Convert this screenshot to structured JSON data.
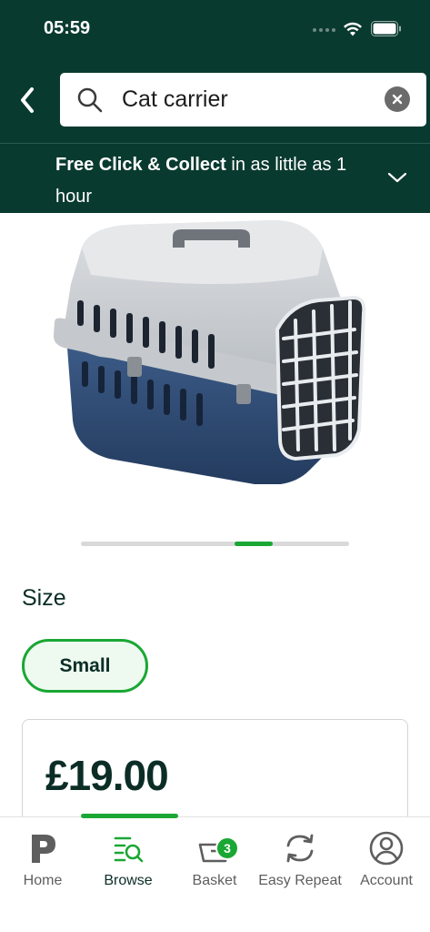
{
  "status_bar": {
    "time": "05:59"
  },
  "search": {
    "query": "Cat carrier"
  },
  "collect_banner": {
    "bold": "Free Click & Collect",
    "rest": " in as little as 1 hour"
  },
  "product": {
    "size_label": "Size",
    "size_option": "Small",
    "price": "£19.00",
    "carousel": {
      "total_pages": 7,
      "active_page": 5
    }
  },
  "tab_bar": {
    "tabs": [
      {
        "label": "Home",
        "icon": "p-logo-icon",
        "active": false
      },
      {
        "label": "Browse",
        "icon": "browse-search-icon",
        "active": true
      },
      {
        "label": "Basket",
        "icon": "basket-icon",
        "active": false,
        "badge": "3"
      },
      {
        "label": "Easy Repeat",
        "icon": "repeat-icon",
        "active": false
      },
      {
        "label": "Account",
        "icon": "account-icon",
        "active": false
      }
    ]
  },
  "colors": {
    "header_bg": "#093a2f",
    "accent_green": "#1aa734",
    "text_dark": "#0b2d26"
  }
}
